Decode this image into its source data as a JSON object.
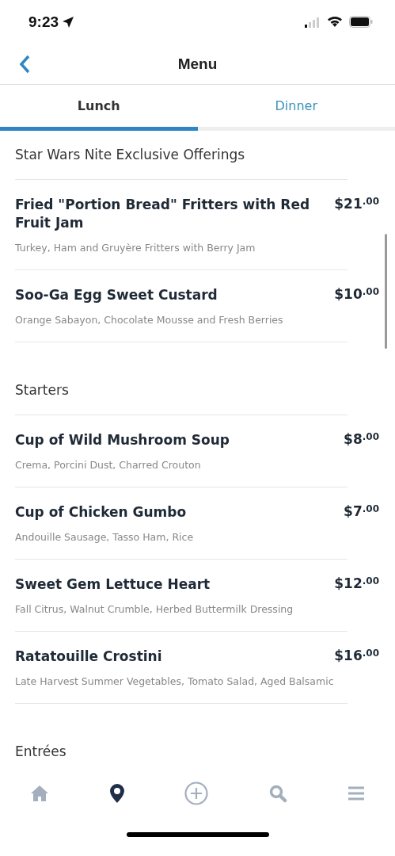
{
  "status_bar": {
    "time": "9:23"
  },
  "nav": {
    "title": "Menu"
  },
  "tabs": [
    {
      "label": "Lunch",
      "selected": true
    },
    {
      "label": "Dinner",
      "selected": false
    }
  ],
  "sections": [
    {
      "title": "Star Wars Nite Exclusive Offerings",
      "items": [
        {
          "name": "Fried \"Portion Bread\" Fritters with Red Fruit Jam",
          "price": "$21$^{.00}$",
          "description": "Turkey, Ham and Gruyère Fritters with Berry Jam"
        },
        {
          "name": "Soo-Ga Egg Sweet Custard",
          "price": "$10$^{.00}$",
          "description": "Orange Sabayon, Chocolate Mousse and Fresh Berries"
        }
      ]
    },
    {
      "title": "Starters",
      "items": [
        {
          "name": "Cup of Wild Mushroom Soup",
          "price": "$8$^{.00}$",
          "description": "Crema, Porcini Dust, Charred Crouton"
        },
        {
          "name": "Cup of Chicken Gumbo",
          "price": "$7$^{.00}$",
          "description": "Andouille Sausage, Tasso Ham, Rice"
        },
        {
          "name": "Sweet Gem Lettuce Heart",
          "price": "$12$^{.00}$",
          "description": "Fall Citrus, Walnut Crumble, Herbed Buttermilk Dressing"
        },
        {
          "name": "Ratatouille Crostini",
          "price": "$16$^{.00}$",
          "description": "Late Harvest Summer Vegetables, Tomato Salad, Aged Balsamic"
        }
      ]
    },
    {
      "title": "Entrées"
    }
  ],
  "tab_bar": [
    {
      "kind": "home",
      "selected": false
    },
    {
      "kind": "pin",
      "selected": true
    },
    {
      "kind": "plus",
      "selected": false
    },
    {
      "kind": "search",
      "selected": false
    },
    {
      "kind": "menu",
      "selected": false
    }
  ]
}
